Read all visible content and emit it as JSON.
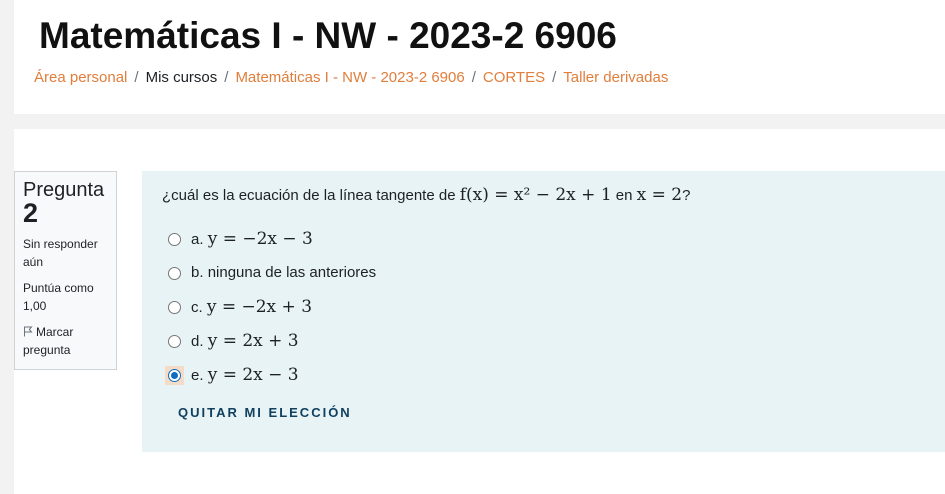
{
  "header": {
    "title": "Matemáticas I - NW - 2023-2 6906",
    "breadcrumb": [
      {
        "label": "Área personal",
        "link": true
      },
      {
        "label": "Mis cursos",
        "link": false
      },
      {
        "label": "Matemáticas I - NW - 2023-2 6906",
        "link": true
      },
      {
        "label": "CORTES",
        "link": true
      },
      {
        "label": "Taller derivadas",
        "link": true
      }
    ],
    "separator": "/"
  },
  "question_info": {
    "label": "Pregunta",
    "number": "2",
    "state": "Sin responder aún",
    "grade": "Puntúa como 1,00",
    "flag_label": "Marcar pregunta",
    "flag_icon": "flag-outline-icon"
  },
  "question": {
    "text_before": "¿cuál es la ecuación de la línea tangente de ",
    "function_math": "f(x) = x² − 2x + 1",
    "text_middle": " en ",
    "point_math": "x = 2",
    "text_after": "?",
    "answers": [
      {
        "letter": "a.",
        "math": "y = −2x − 3",
        "checked": false
      },
      {
        "letter": "b.",
        "text": "ninguna de las anteriores",
        "checked": false
      },
      {
        "letter": "c.",
        "math": "y = −2x + 3",
        "checked": false
      },
      {
        "letter": "d.",
        "math": "y = 2x + 3",
        "checked": false
      },
      {
        "letter": "e.",
        "math": "y = 2x − 3",
        "checked": true
      }
    ],
    "clear_choice_label": "QUITAR MI ELECCIÓN"
  },
  "colors": {
    "link": "#e07e3c",
    "formulation_bg": "#e7f3f5",
    "radio_checked": "#0f6cbf",
    "clear_choice": "#11405f"
  }
}
